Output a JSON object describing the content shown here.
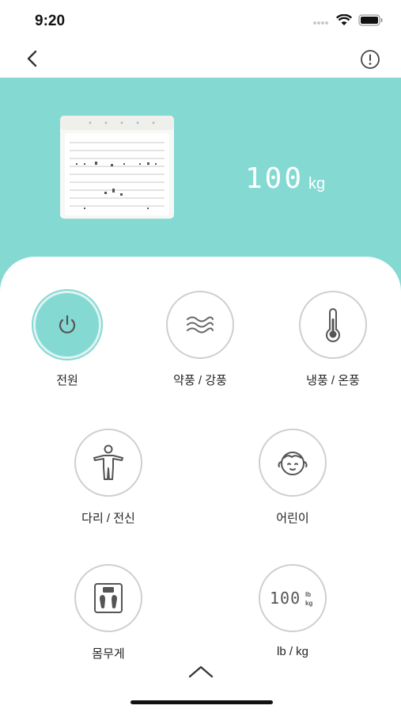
{
  "status_bar": {
    "time": "9:20"
  },
  "hero": {
    "weight_value": "100",
    "weight_unit": "kg"
  },
  "controls": [
    {
      "key": "power",
      "label": "전원",
      "icon": "power-icon",
      "active": true
    },
    {
      "key": "wind",
      "label": "약풍 / 강풍",
      "icon": "wind-waves-icon",
      "active": false
    },
    {
      "key": "temp",
      "label": "냉풍 / 온풍",
      "icon": "thermometer-icon",
      "active": false
    },
    {
      "key": "body",
      "label": "다리 / 전신",
      "icon": "body-figure-icon",
      "active": false
    },
    {
      "key": "child",
      "label": "어린이",
      "icon": "child-face-icon",
      "active": false
    },
    {
      "key": "weigh",
      "label": "몸무게",
      "icon": "scale-icon",
      "active": false
    },
    {
      "key": "unit",
      "label": "lb / kg",
      "icon": "unit-display-icon",
      "active": false
    }
  ],
  "unit_icon_text": {
    "digits": "100",
    "lb": "lb",
    "kg": "kg"
  },
  "colors": {
    "accent": "#84d9d3",
    "border": "#cfcfcf",
    "icon": "#555555"
  }
}
